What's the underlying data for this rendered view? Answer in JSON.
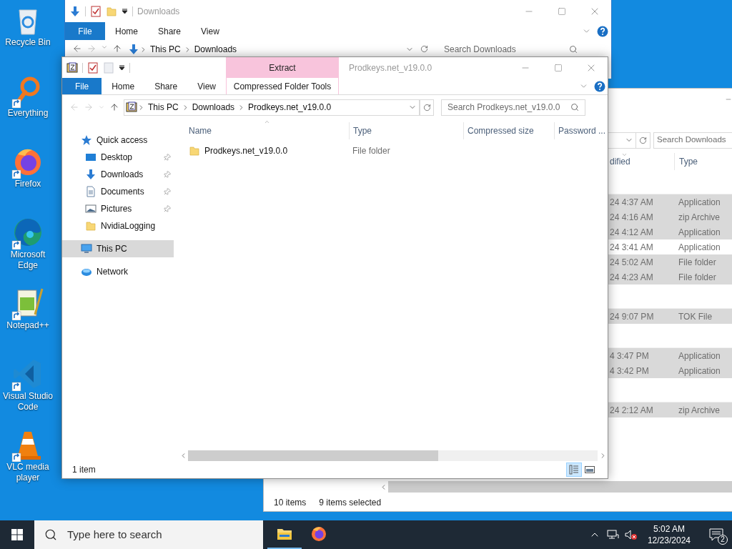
{
  "desktop_icons": [
    {
      "label": "Recycle Bin",
      "kind": "recycle_bin",
      "shortcut": false
    },
    {
      "label": "Everything",
      "kind": "magnifier",
      "shortcut": true
    },
    {
      "label": "Firefox",
      "kind": "firefox",
      "shortcut": true
    },
    {
      "label": "Microsoft Edge",
      "kind": "edge",
      "shortcut": true
    },
    {
      "label": "Notepad++",
      "kind": "notepad",
      "shortcut": true
    },
    {
      "label": "Visual Studio Code",
      "kind": "vscode",
      "shortcut": true
    },
    {
      "label": "VLC media player",
      "kind": "cone",
      "shortcut": true
    }
  ],
  "back_window": {
    "title": "Downloads",
    "file_tab": "File",
    "tabs": [
      "Home",
      "Share",
      "View"
    ],
    "address": [
      "This PC",
      "Downloads"
    ],
    "search_placeholder": "Search Downloads"
  },
  "right_window": {
    "search_placeholder": "Search Downloads",
    "columns": [
      "dified",
      "Type"
    ],
    "rows": [
      {
        "kind": "group"
      },
      {
        "kind": "file",
        "modified": "24 4:37 AM",
        "type": "Application",
        "selected": true
      },
      {
        "kind": "file",
        "modified": "24 4:16 AM",
        "type": "zip Archive",
        "selected": true
      },
      {
        "kind": "file",
        "modified": "24 4:12 AM",
        "type": "Application",
        "selected": true
      },
      {
        "kind": "file",
        "modified": "24 3:41 AM",
        "type": "Application",
        "selected": false
      },
      {
        "kind": "file",
        "modified": "24 5:02 AM",
        "type": "File folder",
        "selected": true
      },
      {
        "kind": "file",
        "modified": "24 4:23 AM",
        "type": "File folder",
        "selected": true
      },
      {
        "kind": "group"
      },
      {
        "kind": "file",
        "modified": "24 9:07 PM",
        "type": "TOK File",
        "selected": true
      },
      {
        "kind": "group"
      },
      {
        "kind": "file",
        "modified": "4 3:47 PM",
        "type": "Application",
        "selected": true
      },
      {
        "kind": "file",
        "modified": "4 3:42 PM",
        "type": "Application",
        "selected": true
      },
      {
        "kind": "group"
      },
      {
        "kind": "file",
        "modified": "24 2:12 AM",
        "type": "zip Archive",
        "selected": true
      }
    ],
    "status": [
      "10 items",
      "9 items selected"
    ]
  },
  "front_window": {
    "title": "Prodkeys.net_v19.0.0",
    "context_tab": "Extract",
    "context_group": "Compressed Folder Tools",
    "file_tab": "File",
    "tabs": [
      "Home",
      "Share",
      "View"
    ],
    "address": [
      "This PC",
      "Downloads",
      "Prodkeys.net_v19.0.0"
    ],
    "search_placeholder": "Search Prodkeys.net_v19.0.0",
    "nav": [
      {
        "label": "Quick access",
        "kind": "star",
        "selected": false,
        "children": [
          {
            "label": "Desktop",
            "kind": "desktop",
            "selected": false,
            "pinned": true
          },
          {
            "label": "Downloads",
            "kind": "download",
            "selected": false,
            "pinned": true
          },
          {
            "label": "Documents",
            "kind": "document",
            "selected": false,
            "pinned": true
          },
          {
            "label": "Pictures",
            "kind": "pictures",
            "selected": false,
            "pinned": true
          },
          {
            "label": "NvidiaLogging",
            "kind": "folder",
            "selected": false,
            "pinned": false
          }
        ]
      },
      {
        "label": "This PC",
        "kind": "pc",
        "selected": true
      },
      {
        "label": "Network",
        "kind": "network",
        "selected": false
      }
    ],
    "columns": [
      "Name",
      "Type",
      "Compressed size",
      "Password ..."
    ],
    "rows": [
      {
        "name": "Prodkeys.net_v19.0.0",
        "type": "File folder"
      }
    ],
    "status": "1 item",
    "views": [
      {
        "kind": "details",
        "selected": true
      },
      {
        "kind": "preview",
        "selected": false
      }
    ]
  },
  "taskbar": {
    "search_placeholder": "Type here to search",
    "apps": [
      {
        "kind": "explorer",
        "active": true
      },
      {
        "kind": "firefox",
        "active": false
      }
    ],
    "time": "5:02 AM",
    "date": "12/23/2024",
    "notifications": "2"
  }
}
